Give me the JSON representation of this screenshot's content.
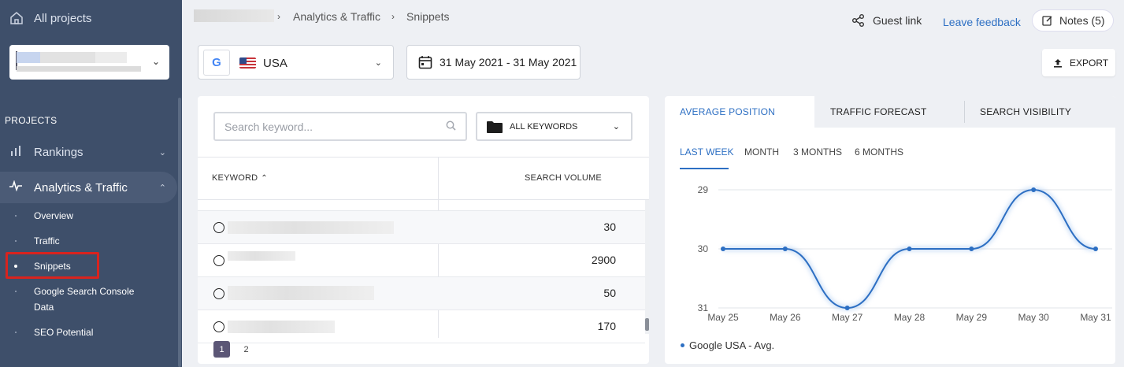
{
  "sidebar": {
    "all_projects": "All projects",
    "projects_heading": "PROJECTS",
    "rankings": "Rankings",
    "analytics": "Analytics & Traffic",
    "sub_items": [
      "Overview",
      "Traffic",
      "Snippets",
      "Google Search Console",
      "Data",
      "SEO Potential"
    ]
  },
  "header": {
    "breadcrumb": [
      "Analytics & Traffic",
      "Snippets"
    ],
    "guest_link": "Guest link",
    "leave_feedback": "Leave feedback",
    "notes": "Notes (5)"
  },
  "filters": {
    "engine": "USA",
    "engine_icon": "G",
    "date_range": "31 May 2021 - 31 May 2021",
    "export": "EXPORT"
  },
  "table": {
    "search_placeholder": "Search keyword...",
    "keyword_filter": "ALL KEYWORDS",
    "columns": [
      "KEYWORD",
      "SEARCH VOLUME"
    ],
    "rows": [
      {
        "volume": "30"
      },
      {
        "volume": "2900"
      },
      {
        "volume": "50"
      },
      {
        "volume": "170"
      }
    ],
    "pages": [
      "1",
      "2"
    ]
  },
  "chart_panel": {
    "tabs": [
      "AVERAGE POSITION",
      "TRAFFIC FORECAST",
      "SEARCH VISIBILITY"
    ],
    "periods": [
      "LAST WEEK",
      "MONTH",
      "3 MONTHS",
      "6 MONTHS"
    ],
    "accent": "#2d6fc3"
  },
  "chart_data": {
    "type": "line",
    "x": [
      "May 25",
      "May 26",
      "May 27",
      "May 28",
      "May 29",
      "May 30",
      "May 31"
    ],
    "series": [
      {
        "name": "Google USA - Avg.",
        "values": [
          30,
          30,
          31,
          30,
          30,
          29,
          30
        ]
      }
    ],
    "y_ticks": [
      "29",
      "30",
      "31"
    ],
    "ylim": [
      29,
      31
    ],
    "y_inverted": true,
    "grid": true,
    "legend": "bottom-left"
  }
}
